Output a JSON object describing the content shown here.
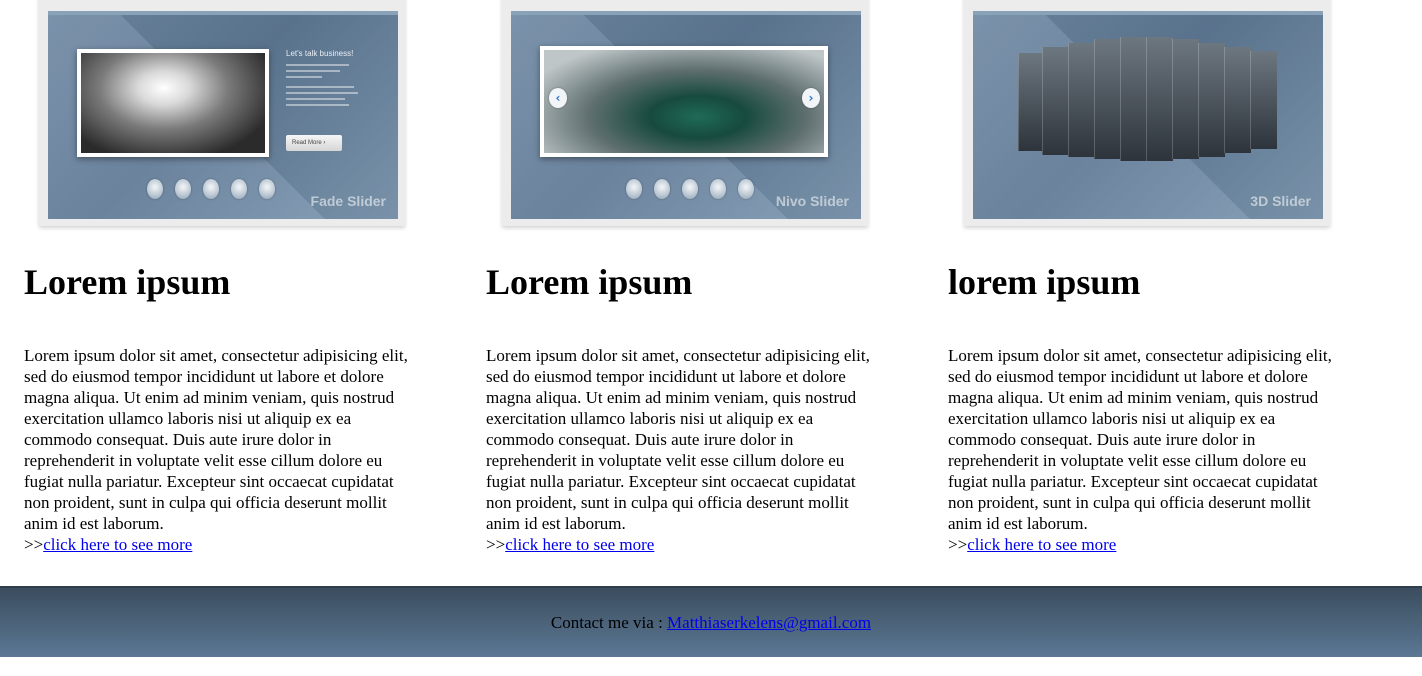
{
  "columns": [
    {
      "thumbnail": {
        "slider_name": "Fade Slider",
        "heading": "Let's talk business!",
        "button": "Read More"
      },
      "title": "Lorem ipsum",
      "body": "Lorem ipsum dolor sit amet, consectetur adipisicing elit, sed do eiusmod tempor incididunt ut labore et dolore magna aliqua. Ut enim ad minim veniam, quis nostrud exercitation ullamco laboris nisi ut aliquip ex ea commodo consequat. Duis aute irure dolor in reprehenderit in voluptate velit esse cillum dolore eu fugiat nulla pariatur. Excepteur sint occaecat cupidatat non proident, sunt in culpa qui officia deserunt mollit anim id est laborum.",
      "more_prefix": ">>",
      "more_link": "click here to see more"
    },
    {
      "thumbnail": {
        "slider_name": "Nivo Slider"
      },
      "title": "Lorem ipsum",
      "body": "Lorem ipsum dolor sit amet, consectetur adipisicing elit, sed do eiusmod tempor incididunt ut labore et dolore magna aliqua. Ut enim ad minim veniam, quis nostrud exercitation ullamco laboris nisi ut aliquip ex ea commodo consequat. Duis aute irure dolor in reprehenderit in voluptate velit esse cillum dolore eu fugiat nulla pariatur. Excepteur sint occaecat cupidatat non proident, sunt in culpa qui officia deserunt mollit anim id est laborum.",
      "more_prefix": ">>",
      "more_link": "click here to see more"
    },
    {
      "thumbnail": {
        "slider_name": "3D Slider"
      },
      "title": "lorem ipsum",
      "body": "Lorem ipsum dolor sit amet, consectetur adipisicing elit, sed do eiusmod tempor incididunt ut labore et dolore magna aliqua. Ut enim ad minim veniam, quis nostrud exercitation ullamco laboris nisi ut aliquip ex ea commodo consequat. Duis aute irure dolor in reprehenderit in voluptate velit esse cillum dolore eu fugiat nulla pariatur. Excepteur sint occaecat cupidatat non proident, sunt in culpa qui officia deserunt mollit anim id est laborum.",
      "more_prefix": ">>",
      "more_link": "click here to see more"
    }
  ],
  "footer": {
    "label": "Contact me via : ",
    "email": "Matthiaserkelens@gmail.com"
  },
  "icons": {
    "prev": "chevron-left-icon",
    "next": "chevron-right-icon"
  },
  "colors": {
    "footer_top": "#3b4d5e",
    "footer_bottom": "#5b7894",
    "link": "#0000ee"
  }
}
